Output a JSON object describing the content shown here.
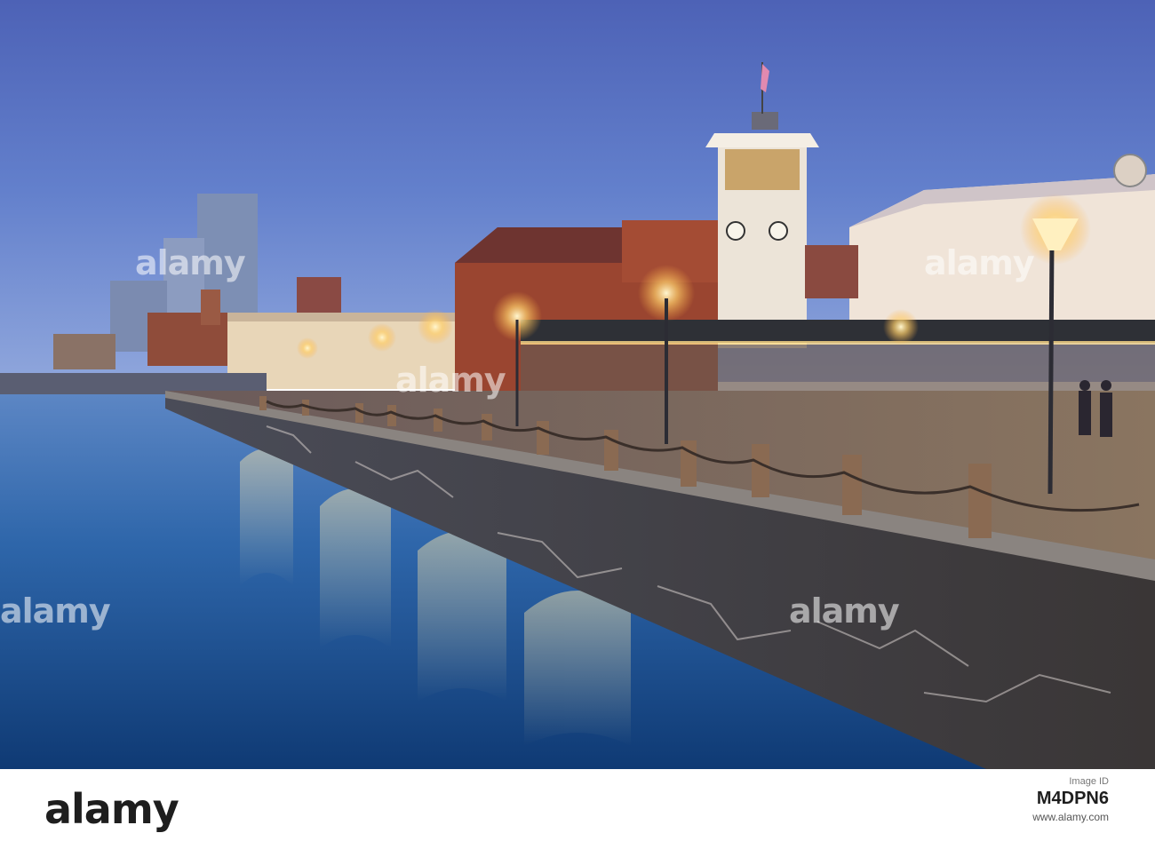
{
  "photo": {
    "description_icon": "photo-image",
    "watermark_text": "alamy",
    "colors": {
      "sky": "#5a78c8",
      "water": "#2a5fa0",
      "lamp": "#ffd27a",
      "brick": "#a04a30",
      "wall": "#3a3a40"
    }
  },
  "footer": {
    "logo": "alamy",
    "label": "Image ID",
    "image_id": "M4DPN6",
    "site": "www.alamy.com"
  }
}
